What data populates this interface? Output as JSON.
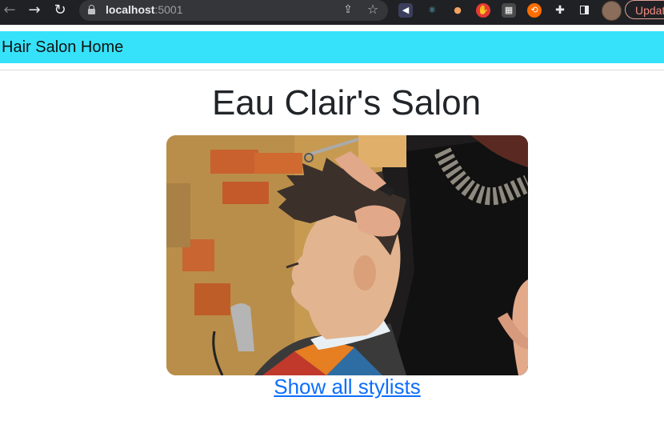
{
  "browser": {
    "url_host": "localhost",
    "url_port": ":5001",
    "update_label": "Update",
    "icons": [
      "back-arrow-icon",
      "forward-arrow-icon",
      "reload-icon",
      "lock-icon",
      "share-icon",
      "bookmark-star-icon",
      "extension-icons",
      "puzzle-icon",
      "sidebar-icon",
      "profile-avatar"
    ]
  },
  "navbar": {
    "brand": "Hair Salon Home",
    "color": "#36e2fa"
  },
  "main": {
    "title": "Eau Clair's Salon",
    "image_alt": "",
    "link_label": "Show all stylists",
    "link_color": "#0d6efd"
  }
}
